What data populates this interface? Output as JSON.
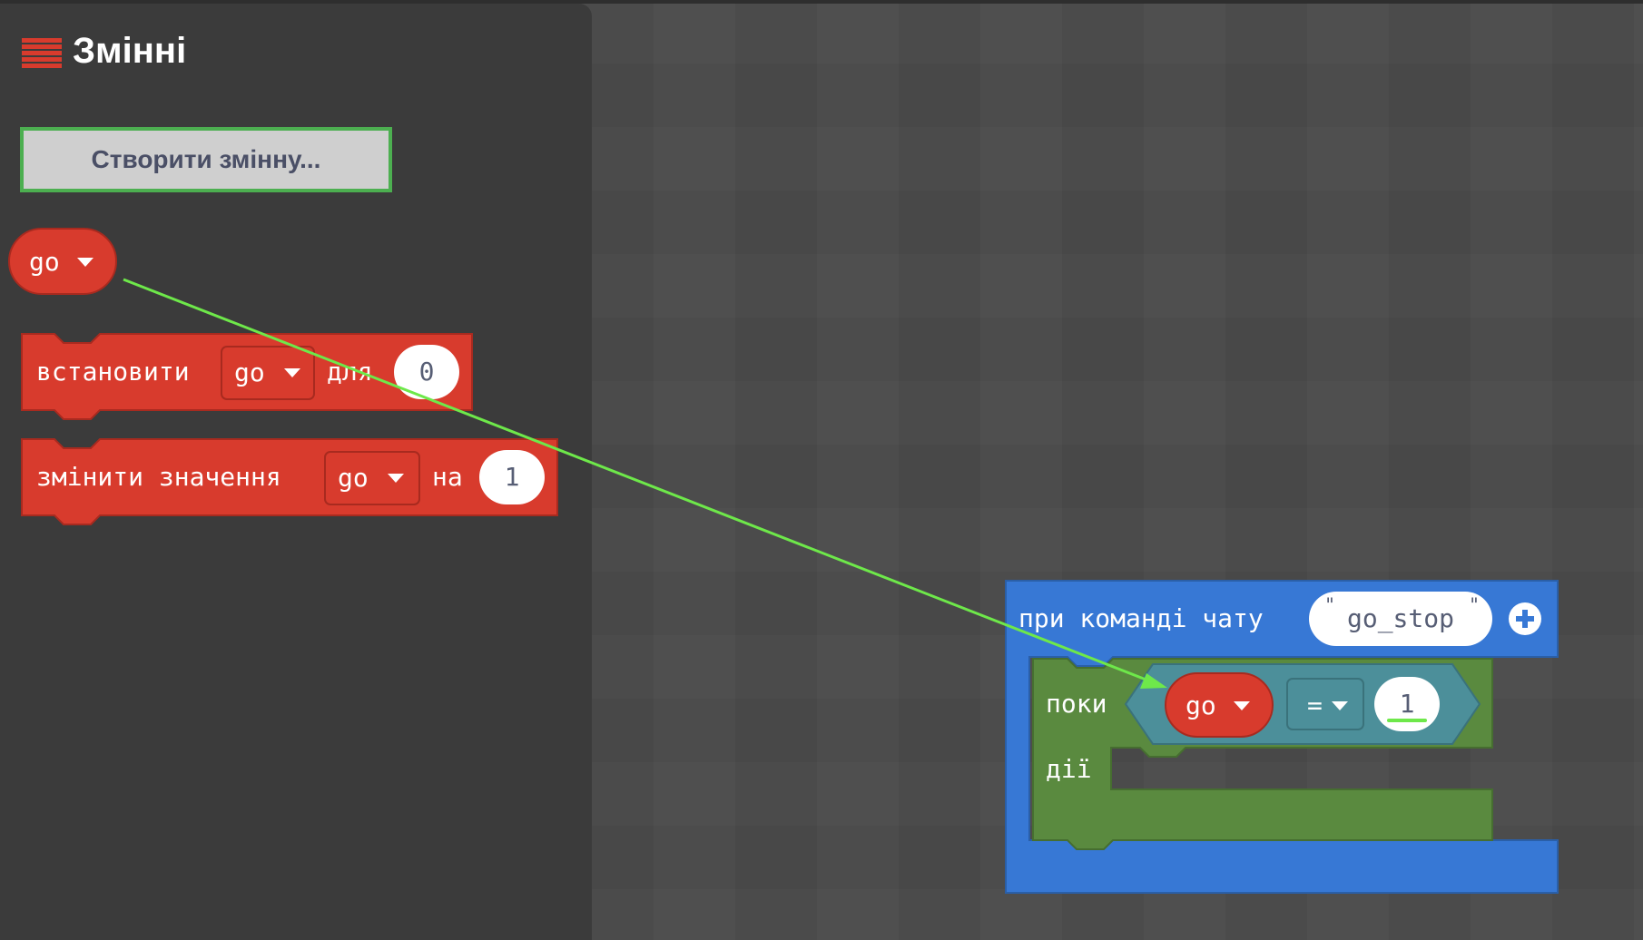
{
  "flyout": {
    "category_title": "Змінні",
    "category_icon": "variables-icon",
    "create_button_label": "Створити змінну..."
  },
  "variable": {
    "name": "go"
  },
  "blocks": {
    "set": {
      "label": "встановити",
      "var": "go",
      "mid": "для",
      "value": "0"
    },
    "change": {
      "label": "змінити значення",
      "var": "go",
      "mid": "на",
      "value": "1"
    }
  },
  "workspace": {
    "chat": {
      "label": "при команді чату",
      "command": "go_stop"
    },
    "while": {
      "label": "поки",
      "do_label": "дії",
      "var": "go",
      "op": "=",
      "value": "1"
    }
  },
  "colors": {
    "variables": "#d83b2d",
    "loops": "#5a8a3f",
    "player": "#3778d5",
    "logic": "#4c8f9a",
    "drag_arrow": "#6ee84a"
  }
}
